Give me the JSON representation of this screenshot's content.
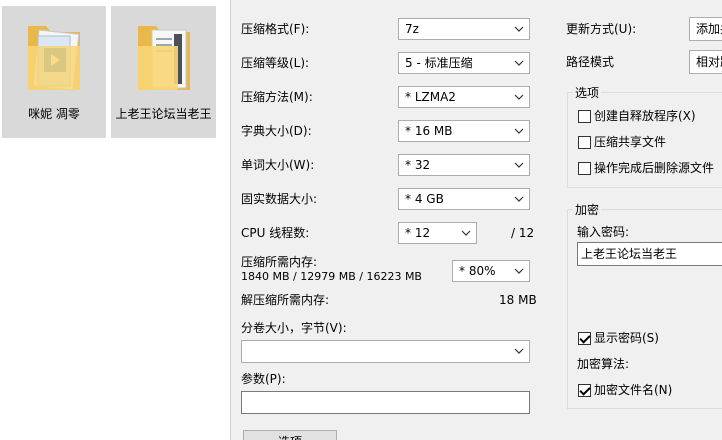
{
  "desktop": {
    "files": [
      {
        "name": "咪妮 凋零",
        "icon": "folder-video-icon"
      },
      {
        "name": "上老王论坛当老王",
        "icon": "folder-document-icon"
      }
    ]
  },
  "dialog": {
    "format": {
      "label": "压缩格式(F):",
      "value": "7z"
    },
    "level": {
      "label": "压缩等级(L):",
      "value": "5 - 标准压缩"
    },
    "method": {
      "label": "压缩方法(M):",
      "value": "* LZMA2"
    },
    "dict": {
      "label": "字典大小(D):",
      "value": "* 16 MB"
    },
    "word": {
      "label": "单词大小(W):",
      "value": "* 32"
    },
    "solid": {
      "label": "固实数据大小:",
      "value": "* 4 GB"
    },
    "cpu": {
      "label": "CPU 线程数:",
      "value": "* 12",
      "max": "/ 12"
    },
    "mem": {
      "label": "压缩所需内存:",
      "detail": "1840 MB / 12979 MB / 16223 MB",
      "value": "* 80%"
    },
    "decomp": {
      "label": "解压缩所需内存:",
      "value": "18 MB"
    },
    "split": {
      "label": "分卷大小，字节(V):",
      "value": ""
    },
    "params": {
      "label": "参数(P):",
      "value": ""
    },
    "options_button": "选项",
    "update": {
      "label": "更新方式(U):",
      "value": "添加并"
    },
    "path": {
      "label": "路径模式",
      "value": "相对路"
    },
    "options_group": {
      "title": "选项",
      "sfx": "创建自释放程序(X)",
      "shared": "压缩共享文件",
      "delete": "操作完成后删除源文件"
    },
    "encryption": {
      "title": "加密",
      "pw_label": "输入密码:",
      "pw_value": "上老王论坛当老王",
      "show_pw": "显示密码(S)",
      "method_label": "加密算法:",
      "encrypt_names": "加密文件名(N)"
    }
  }
}
